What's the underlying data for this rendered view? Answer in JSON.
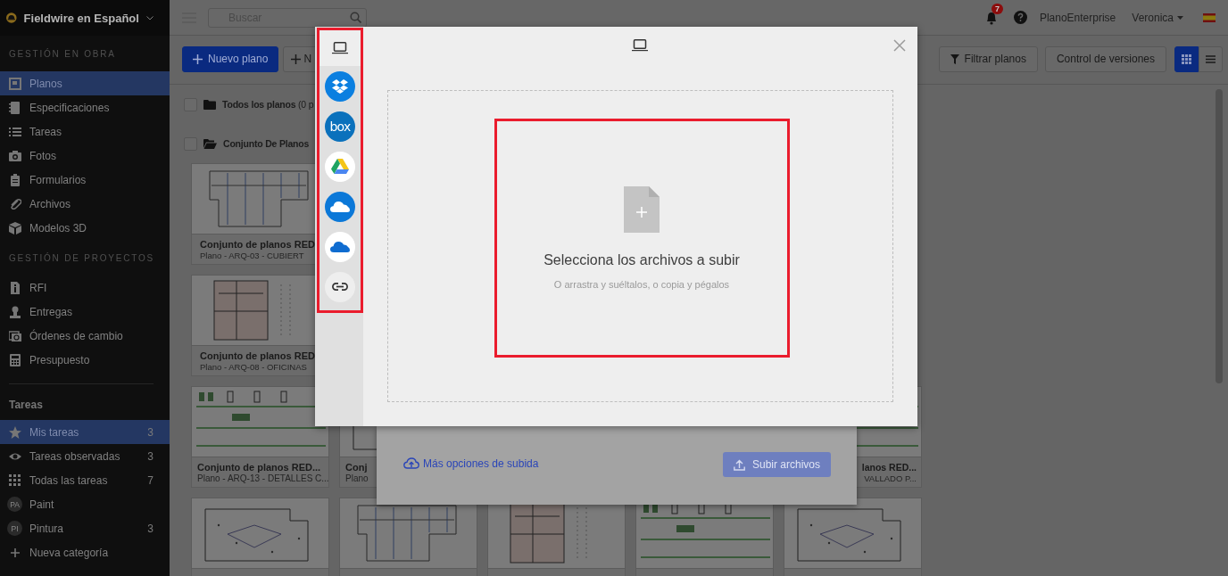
{
  "sidebar": {
    "workspace": "Fieldwire en Español",
    "sections": [
      {
        "heading": "GESTIÓN EN OBRA",
        "items": [
          {
            "label": "Planos",
            "selected": true
          },
          {
            "label": "Especificaciones",
            "selected": false
          },
          {
            "label": "Tareas",
            "selected": false
          },
          {
            "label": "Fotos",
            "selected": false
          },
          {
            "label": "Formularios",
            "selected": false
          },
          {
            "label": "Archivos",
            "selected": false
          },
          {
            "label": "Modelos 3D",
            "selected": false
          }
        ]
      },
      {
        "heading": "GESTIÓN DE PROYECTOS",
        "items": [
          {
            "label": "RFI",
            "selected": false
          },
          {
            "label": "Entregas",
            "selected": false
          },
          {
            "label": "Órdenes de cambio",
            "selected": false
          },
          {
            "label": "Presupuesto",
            "selected": false
          }
        ]
      }
    ],
    "tasks": {
      "heading": "Tareas",
      "items": [
        {
          "kind": "icon",
          "label": "Mis tareas",
          "count": "3",
          "selected": true
        },
        {
          "kind": "icon",
          "label": "Tareas observadas",
          "count": "3",
          "selected": false
        },
        {
          "kind": "icon",
          "label": "Todas las tareas",
          "count": "7",
          "selected": false
        },
        {
          "kind": "avatar",
          "initials": "PA",
          "label": "Paint",
          "selected": false
        },
        {
          "kind": "avatar",
          "initials": "PI",
          "label": "Pintura",
          "count": "3",
          "selected": false
        },
        {
          "kind": "add",
          "label": "Nueva categoría",
          "selected": false
        }
      ]
    }
  },
  "topbar": {
    "search": {
      "placeholder": "Buscar"
    },
    "notifications": {
      "count": "7"
    },
    "organization": "PlanoEnterprise",
    "user": "Veronica"
  },
  "toolbar": {
    "buttons": [
      {
        "kind": "primary",
        "label": "Nuevo plano"
      },
      {
        "kind": "outline",
        "label": "N"
      }
    ],
    "right_buttons": [
      {
        "kind": "filter",
        "label": "Filtrar planos"
      },
      {
        "kind": "plain",
        "label": "Control de versiones"
      }
    ],
    "views": [
      {
        "kind": "grid",
        "selected": true
      },
      {
        "kind": "list",
        "selected": false
      }
    ]
  },
  "folders": [
    {
      "kind": "closed",
      "label": "Todos los planos",
      "count": "(0 p",
      "checked": false
    },
    {
      "kind": "open",
      "label": "Conjunto De Planos",
      "checked": false
    }
  ],
  "plan_rows": [
    [
      {
        "kind": "covered",
        "title": "Conjunto de planos RED",
        "subtitle": "Plano - ARQ-03 - CUBIERT"
      },
      null,
      null,
      null,
      null
    ],
    [
      {
        "kind": "covered",
        "title": "Conjunto de planos RED",
        "subtitle": "Plano - ARQ-08 - OFICINAS"
      },
      null,
      null,
      null,
      null
    ],
    [
      {
        "kind": "captioned",
        "title": "Conjunto de planos RED...",
        "subtitle": "Plano - ARQ-13 - DETALLES C..."
      },
      {
        "kind": "captioned",
        "title": "Conj",
        "subtitle": "Plano"
      },
      null,
      null,
      {
        "kind": "tail",
        "title": "lanos RED...",
        "subtitle": "VALLADO P..."
      }
    ],
    [
      {
        "kind": "thumbnail"
      },
      {
        "kind": "thumbnail"
      },
      {
        "kind": "thumbnail"
      },
      {
        "kind": "thumbnail"
      },
      {
        "kind": "thumbnail"
      }
    ]
  ],
  "upload_dialog": {
    "link": "Más opciones de subida",
    "button": {
      "label": "Subir archivos",
      "disabled": true
    }
  },
  "file_picker": {
    "sources": [
      {
        "kind": "device",
        "selected": true
      },
      {
        "kind": "dropbox",
        "selected": false
      },
      {
        "kind": "box",
        "logo_text": "box",
        "selected": false
      },
      {
        "kind": "drive",
        "selected": false
      },
      {
        "kind": "onedrive",
        "selected": false
      },
      {
        "kind": "onedrive-business",
        "selected": false
      },
      {
        "kind": "link",
        "selected": false
      }
    ],
    "sources_highlighted": true,
    "drop_zone": {
      "highlighted": true,
      "title": "Selecciona los archivos a subir",
      "hint": "O arrastra y suéltalos, o copia y pégalos"
    }
  }
}
